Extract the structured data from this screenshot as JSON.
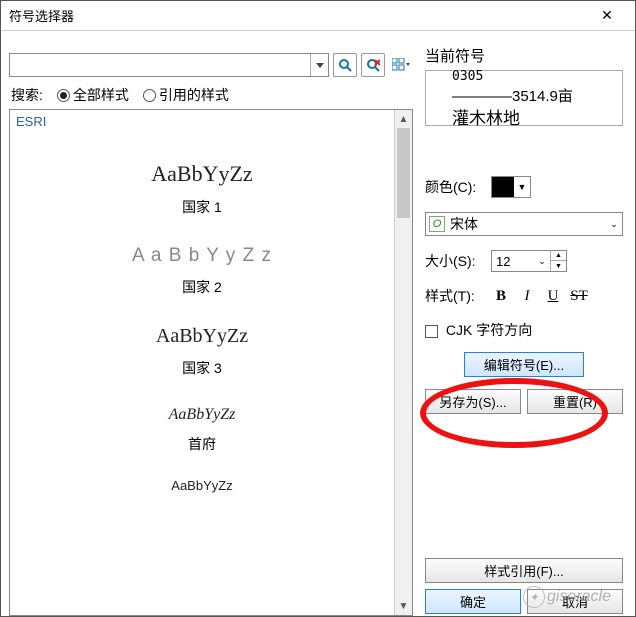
{
  "window": {
    "title": "符号选择器",
    "close": "✕"
  },
  "toolbar": {
    "search_value": "",
    "search_placeholder": ""
  },
  "search": {
    "label": "搜索:",
    "radio_all": "全部样式",
    "radio_quoted": "引用的样式"
  },
  "list": {
    "header": "ESRI",
    "items": [
      {
        "sample": "AaBbYyZz",
        "label": "国家 1",
        "cls": "s1"
      },
      {
        "sample": "A a B b Y y Z z",
        "label": "国家 2",
        "cls": "s2"
      },
      {
        "sample": "AaBbYyZz",
        "label": "国家 3",
        "cls": "s3"
      },
      {
        "sample": "AaBbYyZz",
        "label": "首府",
        "cls": "s4"
      },
      {
        "sample": "AaBbYyZz",
        "label": "",
        "cls": "s5"
      }
    ]
  },
  "current": {
    "label": "当前符号",
    "line1": "0305",
    "line2": "————3514.9亩",
    "line3": "灌木林地"
  },
  "props": {
    "color_label": "颜色(C):",
    "color_value": "#000000",
    "font_name": "宋体",
    "size_label": "大小(S):",
    "size_value": "12",
    "style_label": "样式(T):",
    "cjk_label": "CJK 字符方向"
  },
  "buttons": {
    "edit_symbol": "编辑符号(E)...",
    "save_as": "另存为(S)...",
    "reset": "重置(R)",
    "style_ref": "样式引用(F)...",
    "ok": "确定",
    "cancel": "取消"
  },
  "watermark": "gisoracle"
}
